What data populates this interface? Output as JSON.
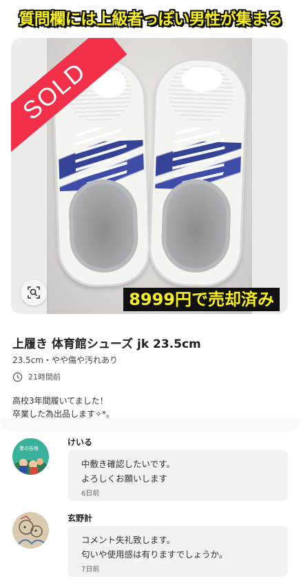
{
  "headline": "質問欄には上級者っぽい男性が集まる",
  "photo": {
    "sold_label": "SOLD",
    "price_overlay": "8999円で売却済み",
    "zoom_icon": "zoom-search-icon"
  },
  "item": {
    "title": "上履き 体育館シューズ jk 23.5cm",
    "subinfo": "23.5cm・やや傷や汚れあり",
    "time": "21時間前",
    "description": [
      "高校3年間履いてました！",
      "卒業した為出品します✧*。"
    ]
  },
  "comments": [
    {
      "name": "けいる",
      "lines": [
        "中敷き確認したいです。",
        "よろしくお願いします"
      ],
      "ago": "6日前",
      "avatar_text": "愛の告格"
    },
    {
      "name": "玄野計",
      "lines": [
        "コメント失礼致します。",
        "匂いや使用感は有りますでしょうか。"
      ],
      "ago": "7日前"
    }
  ],
  "colors": {
    "headline_text": "#f6ef20",
    "sold_band": "#f2304a",
    "bubble_bg": "#f2f2f2"
  }
}
